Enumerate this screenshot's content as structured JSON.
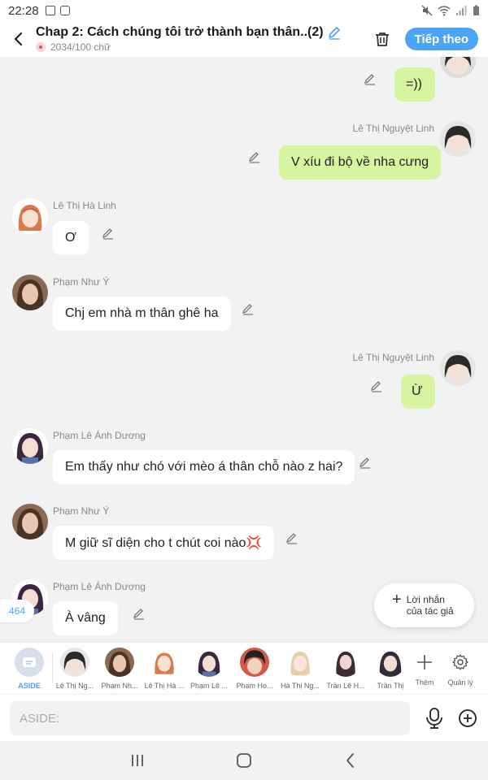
{
  "status_bar": {
    "time": "22:28"
  },
  "header": {
    "title": "Chap 2: Cách chúng tôi trở thành bạn thân..(2)",
    "word_count": "2034/100 chữ",
    "follow_label": "Tiếp theo"
  },
  "messages": [
    {
      "sender": "",
      "text": "=))",
      "side": "right"
    },
    {
      "sender": "Lê Thị Nguyệt Linh",
      "text": "V xíu đi bộ về nha cưng",
      "side": "right"
    },
    {
      "sender": "Lê Thị Hà Linh",
      "text": "Ơ",
      "side": "left"
    },
    {
      "sender": "Phạm Như Ý",
      "text": "Chj em nhà m thân ghê ha",
      "side": "left"
    },
    {
      "sender": "Lê Thị Nguyệt Linh",
      "text": "Ừ",
      "side": "right"
    },
    {
      "sender": "Phạm Lê Ánh Dương",
      "text": "Em thấy như chó với mèo á thân chỗ nào z hai?",
      "side": "left"
    },
    {
      "sender": "Phạm Như Ý",
      "text": "M giữ sĩ diện cho t chút coi nào💢",
      "side": "left"
    },
    {
      "sender": "Phạm Lê Ánh Dương",
      "text": "À vâng",
      "side": "left"
    }
  ],
  "aside_count": "464",
  "author_note": {
    "line1": "Lời nhắn",
    "line2": "của tác giả"
  },
  "characters": [
    {
      "label": "ASIDE"
    },
    {
      "label": "Lê Thị Ng..."
    },
    {
      "label": "Phạm Nh..."
    },
    {
      "label": "Lê Thị Hà ..."
    },
    {
      "label": "Phạm Lê ..."
    },
    {
      "label": "Phạm Ho..."
    },
    {
      "label": "Hà Thị Ng..."
    },
    {
      "label": "Trần Lê H..."
    },
    {
      "label": "Trần Thị"
    }
  ],
  "char_actions": {
    "add_label": "Thêm",
    "manage_label": "Quản lý"
  },
  "input": {
    "placeholder": "ASIDE:"
  },
  "colors": {
    "accent": "#4da3f5",
    "right_bubble": "#d5f5a0",
    "background": "#f2f2f2"
  }
}
